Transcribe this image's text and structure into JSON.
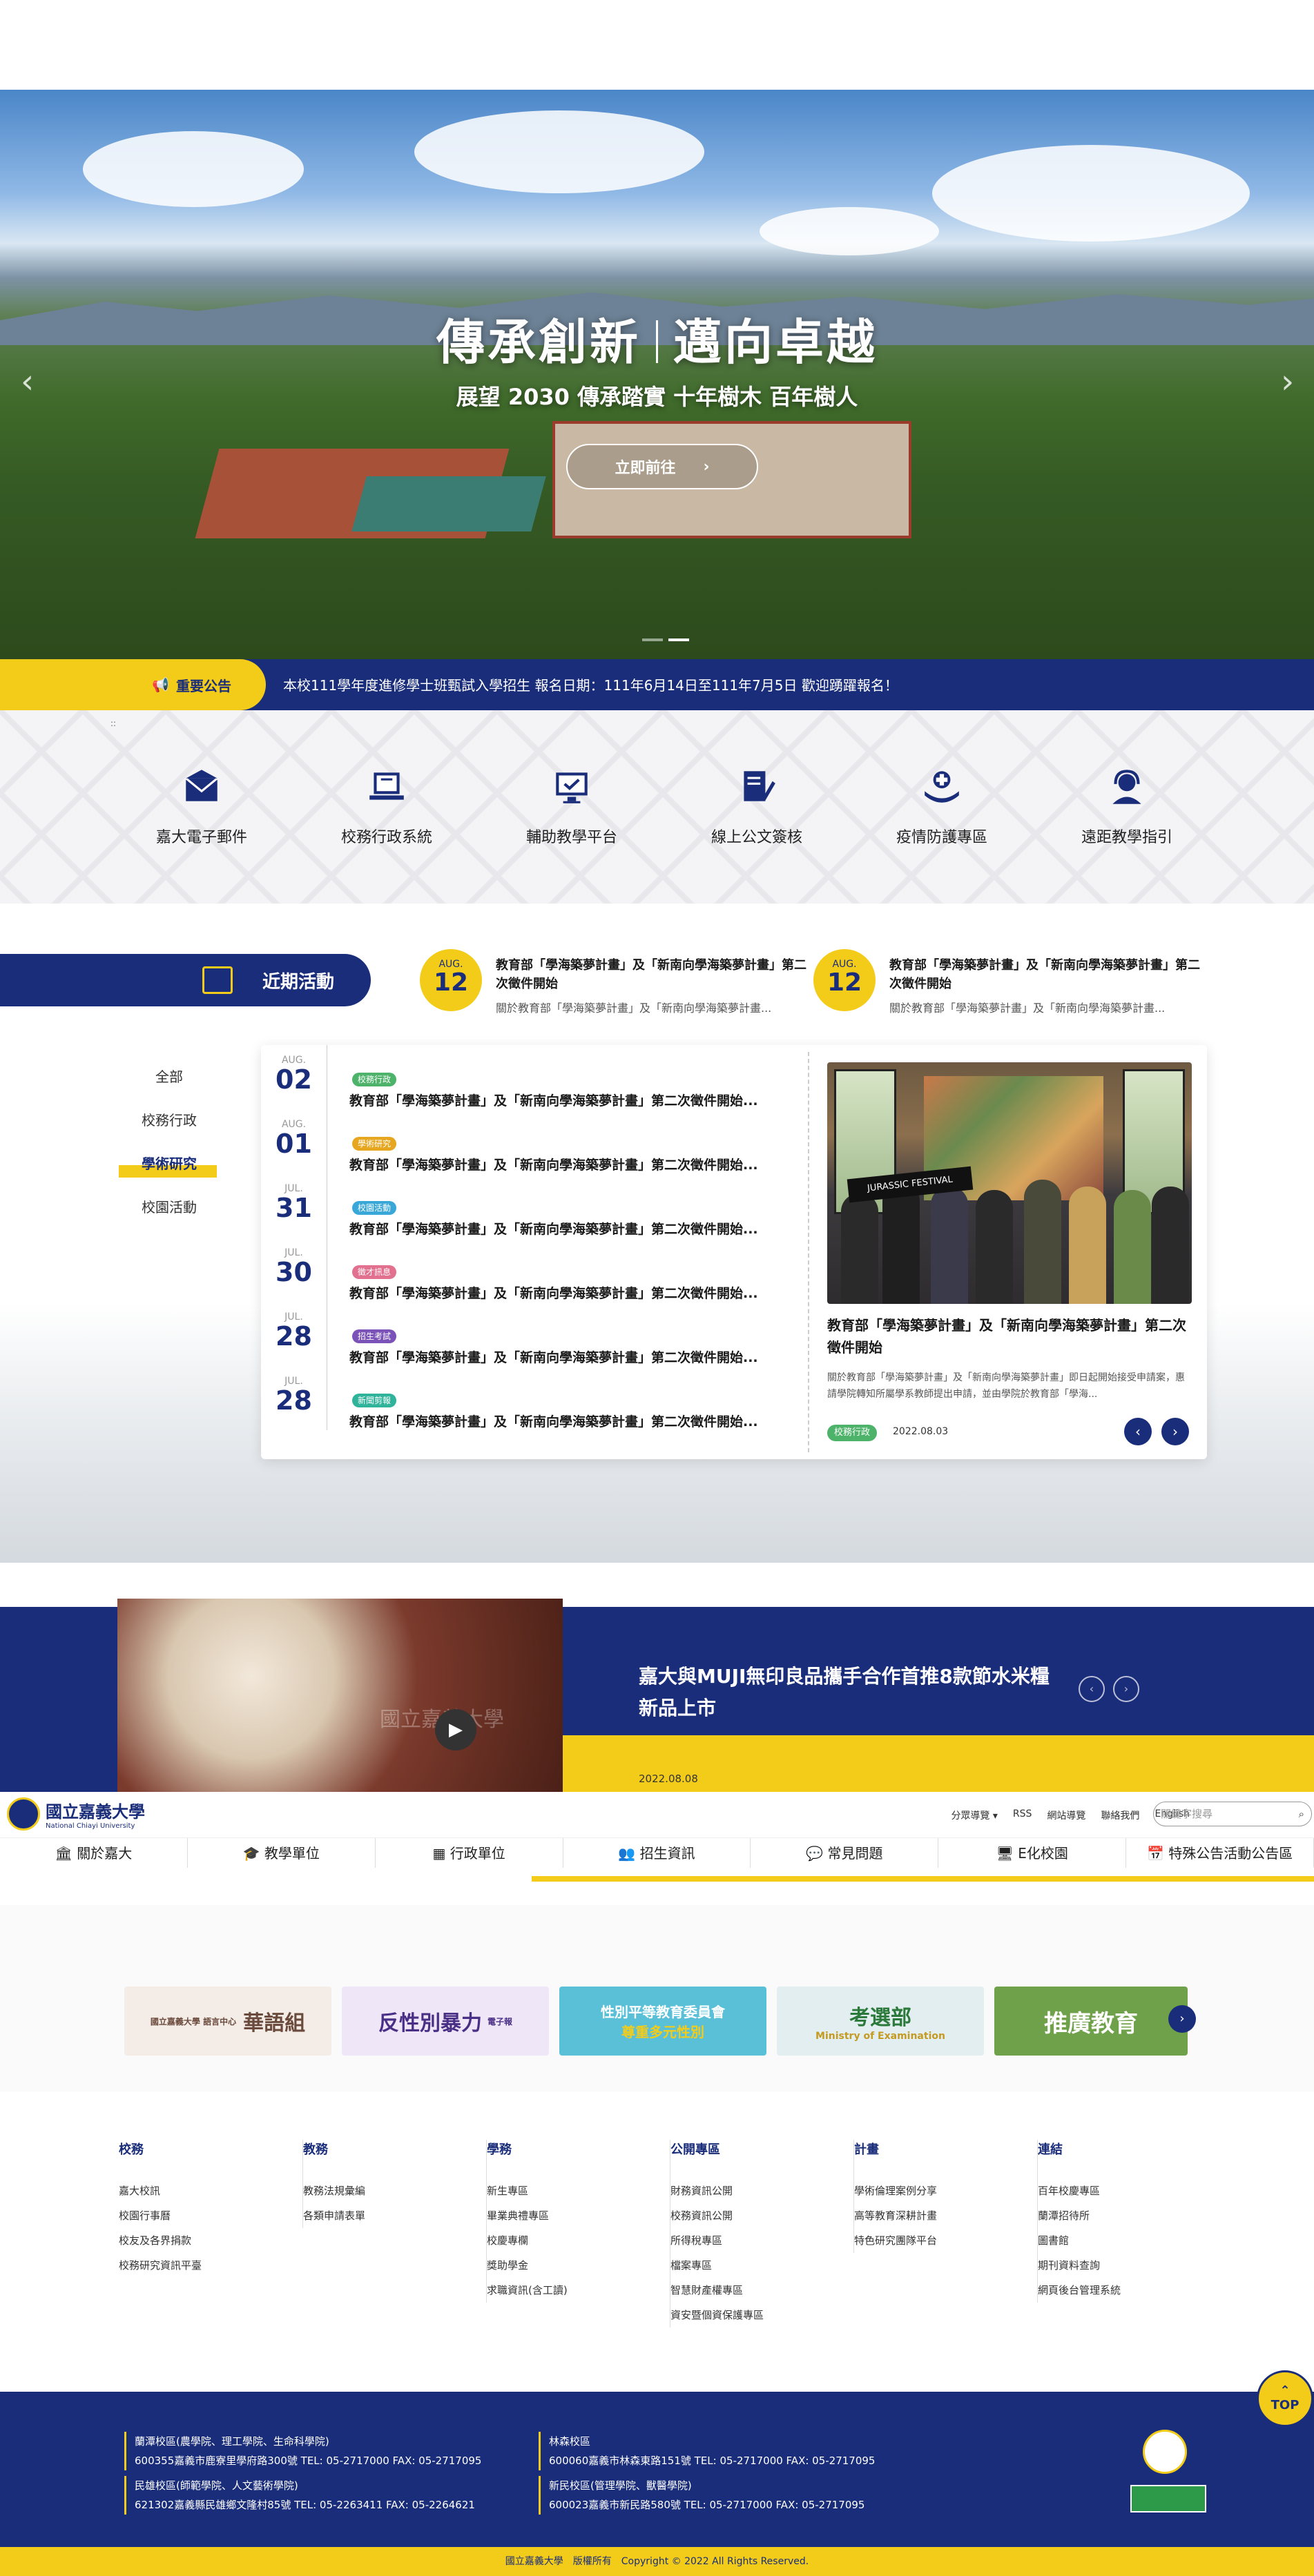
{
  "hero": {
    "title_left": "傳承創新",
    "title_right": "邁向卓越",
    "subtitle": "展望 2030 傳承踏實 十年樹木 百年樹人",
    "button_label": "立即前往"
  },
  "announcement": {
    "label": "重要公告",
    "text": "本校111學年度進修學士班甄試入學招生 報名日期：111年6月14日至111年7月5日 歡迎踴躍報名！"
  },
  "quick_links": [
    {
      "label": "嘉大電子郵件",
      "icon": "email-icon"
    },
    {
      "label": "校務行政系統",
      "icon": "laptop-icon"
    },
    {
      "label": "輔助教學平台",
      "icon": "monitor-check-icon"
    },
    {
      "label": "線上公文簽核",
      "icon": "document-sign-icon"
    },
    {
      "label": "疫情防護專區",
      "icon": "medical-hand-icon"
    },
    {
      "label": "遠距教學指引",
      "icon": "headset-icon"
    }
  ],
  "events": {
    "heading": "近期活動",
    "top": [
      {
        "month": "AUG.",
        "day": "12",
        "title": "教育部「學海築夢計畫」及「新南向學海築夢計畫」第二次徵件開始",
        "summary": "關於教育部「學海築夢計畫」及「新南向學海築夢計畫..."
      },
      {
        "month": "AUG.",
        "day": "12",
        "title": "教育部「學海築夢計畫」及「新南向學海築夢計畫」第二次徵件開始",
        "summary": "關於教育部「學海築夢計畫」及「新南向學海築夢計畫..."
      }
    ],
    "categories": [
      "全部",
      "校務行政",
      "學術研究",
      "校園活動"
    ],
    "active_category": "學術研究",
    "list": [
      {
        "month": "AUG.",
        "day": "02",
        "tag": "校務行政",
        "tag_color": "#4eb36a",
        "title": "教育部「學海築夢計畫」及「新南向學海築夢計畫」第二次徵件開始..."
      },
      {
        "month": "AUG.",
        "day": "01",
        "tag": "學術研究",
        "tag_color": "#e6a620",
        "title": "教育部「學海築夢計畫」及「新南向學海築夢計畫」第二次徵件開始..."
      },
      {
        "month": "JUL.",
        "day": "31",
        "tag": "校園活動",
        "tag_color": "#3aa7d9",
        "title": "教育部「學海築夢計畫」及「新南向學海築夢計畫」第二次徵件開始..."
      },
      {
        "month": "JUL.",
        "day": "30",
        "tag": "徵才訊息",
        "tag_color": "#e2708f",
        "title": "教育部「學海築夢計畫」及「新南向學海築夢計畫」第二次徵件開始..."
      },
      {
        "month": "JUL.",
        "day": "28",
        "tag": "招生考試",
        "tag_color": "#7a52b8",
        "title": "教育部「學海築夢計畫」及「新南向學海築夢計畫」第二次徵件開始..."
      },
      {
        "month": "JUL.",
        "day": "28",
        "tag": "新聞剪報",
        "tag_color": "#2fb39a",
        "title": "教育部「學海築夢計畫」及「新南向學海築夢計畫」第二次徵件開始..."
      }
    ],
    "featured": {
      "title": "教育部「學海築夢計畫」及「新南向學海築夢計畫」第二次徵件開始",
      "desc": "關於教育部「學海築夢計畫」及「新南向學海築夢計畫」即日起開始接受申請案，惠請學院轉知所屬學系教師提出申請，並由學院於教育部「學海...",
      "tag": "校務行政",
      "date": "2022.08.03",
      "banner_text": "JURASSIC FESTIVAL"
    }
  },
  "muji": {
    "title": "嘉大與MUJI無印良品攜手合作首推8款節水米糧新品上市",
    "date": "2022.08.08",
    "video_watermark": "國立嘉義大學"
  },
  "header": {
    "logo_name": "國立嘉義大學",
    "logo_en": "National Chiayi University",
    "top_links": [
      "分眾導覽",
      "RSS",
      "網站導覽",
      "聯絡我們",
      "English"
    ],
    "search_placeholder": "關鍵字搜尋",
    "nav": [
      {
        "label": "關於嘉大",
        "icon": "building-icon"
      },
      {
        "label": "教學單位",
        "icon": "graduation-cap-icon"
      },
      {
        "label": "行政單位",
        "icon": "calendar-icon"
      },
      {
        "label": "招生資訊",
        "icon": "users-icon"
      },
      {
        "label": "常見問題",
        "icon": "chat-icon"
      },
      {
        "label": "E化校園",
        "icon": "computer-icon"
      },
      {
        "label": "特殊公告活動公告區",
        "icon": "calendar-alt-icon"
      }
    ]
  },
  "banners": [
    {
      "text": "華語組",
      "sub": "國立嘉義大學 語言中心",
      "bg": "#f4ece6",
      "fg": "#6a4a3c"
    },
    {
      "text": "反性別暴力",
      "sub": "電子報",
      "bg": "#efe7f7",
      "fg": "#4a2f86"
    },
    {
      "text": "性別平等教育委員會",
      "sub": "尊重多元性別",
      "bg": "#5ac0d8",
      "fg": "#ffffff"
    },
    {
      "text": "考選部",
      "sub": "Ministry of Examination",
      "bg": "#e3eef0",
      "fg": "#2b7a3c"
    },
    {
      "text": "推廣教育",
      "sub": "",
      "bg": "#6ea14a",
      "fg": "#ffffff"
    }
  ],
  "footer_links": [
    {
      "heading": "校務",
      "items": [
        "嘉大校訊",
        "校園行事曆",
        "校友及各界捐款",
        "校務研究資訊平臺"
      ]
    },
    {
      "heading": "教務",
      "items": [
        "教務法規彙編",
        "各類申請表單"
      ]
    },
    {
      "heading": "學務",
      "items": [
        "新生專區",
        "畢業典禮專區",
        "校慶專欄",
        "獎助學金",
        "求職資訊(含工讀)"
      ]
    },
    {
      "heading": "公開專區",
      "items": [
        "財務資訊公開",
        "校務資訊公開",
        "所得稅專區",
        "檔案專區",
        "智慧財產權專區",
        "資安暨個資保護專區"
      ]
    },
    {
      "heading": "計畫",
      "items": [
        "學術倫理案例分享",
        "高等教育深耕計畫",
        "特色研究團隊平台"
      ]
    },
    {
      "heading": "連結",
      "items": [
        "百年校慶專區",
        "蘭潭招待所",
        "圖書館",
        "期刊資料查詢",
        "網頁後台管理系統"
      ]
    }
  ],
  "campuses": [
    {
      "name": "蘭潭校區(農學院、理工學院、生命科學院)",
      "addr": "600355嘉義市鹿寮里學府路300號 TEL: 05-2717000 FAX: 05-2717095"
    },
    {
      "name": "林森校區",
      "addr": "600060嘉義市林森東路151號 TEL: 05-2717000 FAX: 05-2717095"
    },
    {
      "name": "民雄校區(師範學院、人文藝術學院)",
      "addr": "621302嘉義縣民雄鄉文隆村85號 TEL: 05-2263411 FAX: 05-2264621"
    },
    {
      "name": "新民校區(管理學院、獸醫學院)",
      "addr": "600023嘉義市新民路580號 TEL: 05-2717000 FAX: 05-2717095"
    }
  ],
  "top_button": "TOP",
  "copyright": "國立嘉義大學　版權所有　Copyright © 2022 All Rights Reserved."
}
